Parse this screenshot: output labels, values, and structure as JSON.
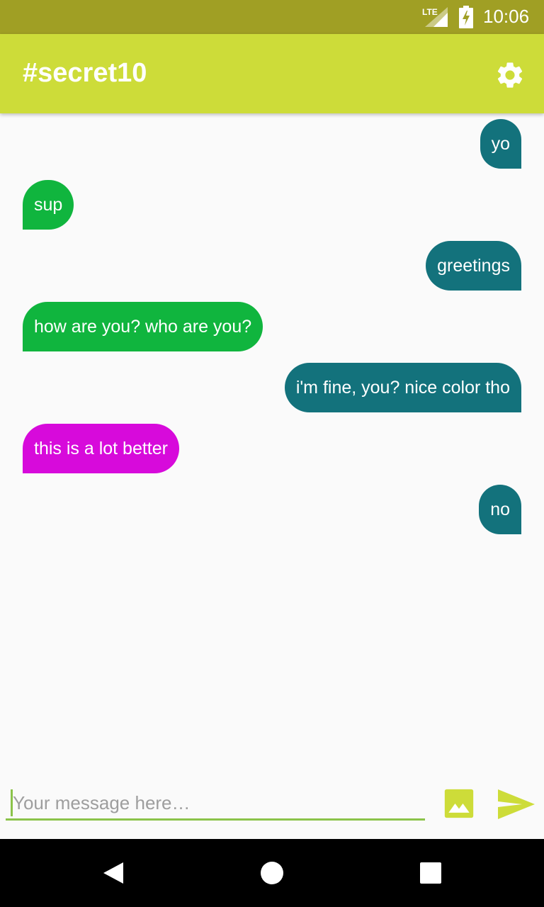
{
  "status_bar": {
    "network": "LTE",
    "time": "10:06"
  },
  "app_bar": {
    "title": "#secret10",
    "settings_icon": "gear-icon"
  },
  "messages": [
    {
      "text": "yo",
      "direction": "outgoing",
      "color": "#13727c"
    },
    {
      "text": "sup",
      "direction": "incoming",
      "color": "#10b53e"
    },
    {
      "text": "greetings",
      "direction": "outgoing",
      "color": "#13727c"
    },
    {
      "text": "how are you? who are you?",
      "direction": "incoming",
      "color": "#10b53e"
    },
    {
      "text": "i'm fine, you? nice color tho",
      "direction": "outgoing",
      "color": "#13727c"
    },
    {
      "text": "this is a lot better",
      "direction": "incoming",
      "color": "#d70adb"
    },
    {
      "text": "no",
      "direction": "outgoing",
      "color": "#13727c"
    }
  ],
  "composer": {
    "value": "",
    "placeholder": "Your message here…",
    "image_icon": "image-icon",
    "send_icon": "send-icon"
  },
  "colors": {
    "status_bar": "#a09f24",
    "app_bar": "#cddc39",
    "accent": "#8bc34a",
    "outgoing_bubble": "#13727c",
    "incoming_bubble_green": "#10b53e",
    "incoming_bubble_magenta": "#d70adb"
  },
  "nav_bar": {
    "buttons": [
      "back-icon",
      "home-icon",
      "recents-icon"
    ]
  }
}
